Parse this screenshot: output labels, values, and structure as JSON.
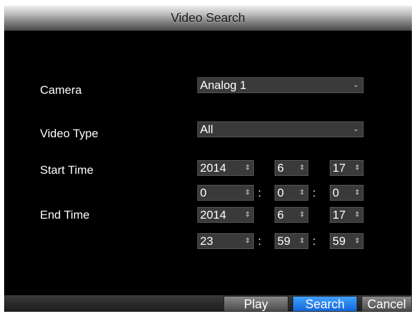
{
  "window": {
    "title": "Video Search"
  },
  "form": {
    "camera": {
      "label": "Camera",
      "value": "Analog 1"
    },
    "video_type": {
      "label": "Video Type",
      "value": "All"
    },
    "start_time": {
      "label": "Start Time",
      "year": "2014",
      "month": "6",
      "day": "17",
      "hour": "0",
      "minute": "0",
      "second": "0"
    },
    "end_time": {
      "label": "End Time",
      "year": "2014",
      "month": "6",
      "day": "17",
      "hour": "23",
      "minute": "59",
      "second": "59"
    },
    "time_separator": ":"
  },
  "icons": {
    "dropdown": "chevron-down-icon",
    "spinner": "up-down-arrows-icon"
  },
  "buttons": {
    "play": "Play",
    "search": "Search",
    "cancel": "Cancel"
  },
  "colors": {
    "accent": "#1f7ff0",
    "background": "#000000"
  }
}
